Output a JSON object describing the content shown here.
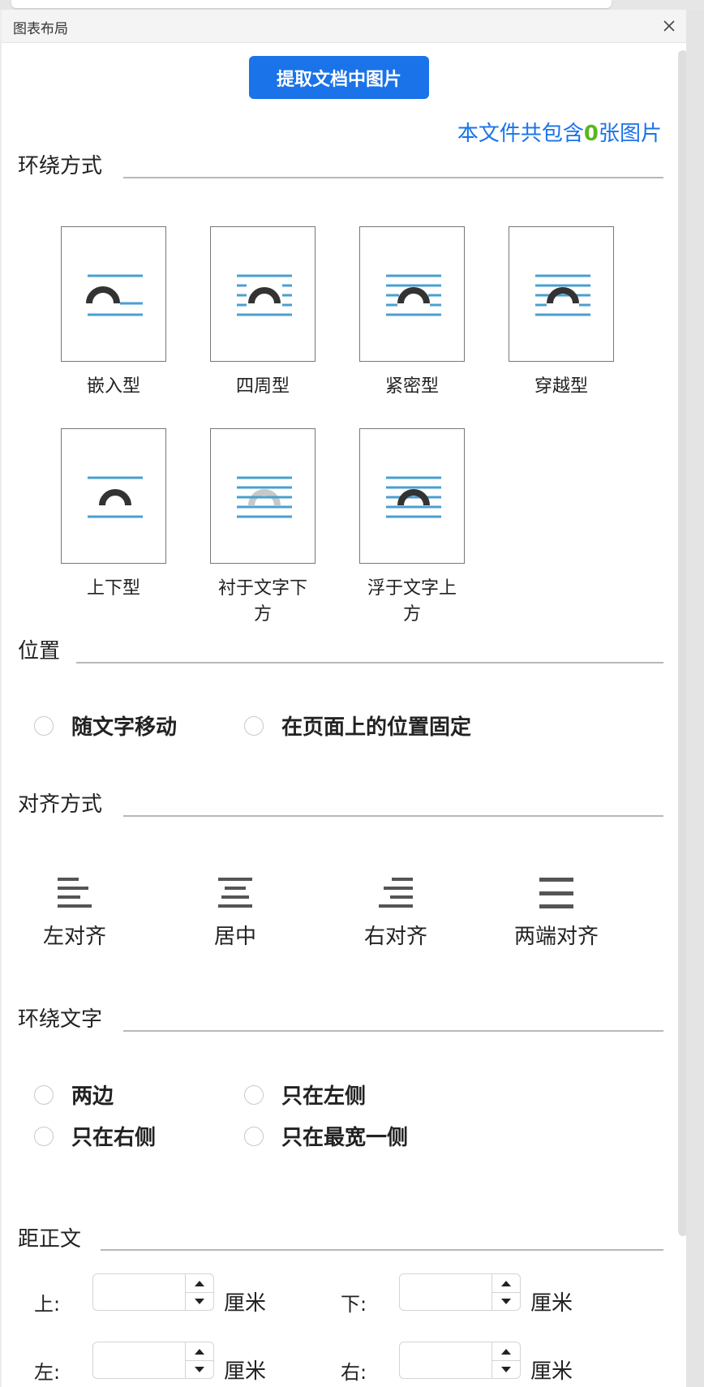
{
  "dialog": {
    "title": "图表布局"
  },
  "extract": {
    "button_label": "提取文档中图片",
    "count_prefix": "本文件共包含",
    "count": "0",
    "count_suffix": "张图片"
  },
  "sections": {
    "wrap_mode": "环绕方式",
    "position": "位置",
    "alignment": "对齐方式",
    "wrap_text": "环绕文字",
    "distance": "距正文"
  },
  "wrap_modes": [
    "嵌入型",
    "四周型",
    "紧密型",
    "穿越型",
    "上下型",
    "衬于文字下方",
    "浮于文字上方"
  ],
  "position_options": [
    "随文字移动",
    "在页面上的位置固定"
  ],
  "alignment_options": [
    "左对齐",
    "居中",
    "右对齐",
    "两端对齐"
  ],
  "wrap_text_options": [
    "两边",
    "只在左侧",
    "只在右侧",
    "只在最宽一侧"
  ],
  "distance": {
    "top_label": "上:",
    "bottom_label": "下:",
    "left_label": "左:",
    "right_label": "右:",
    "unit": "厘米",
    "top_value": "",
    "bottom_value": "",
    "left_value": "",
    "right_value": ""
  },
  "colors": {
    "accent": "#1a73e8",
    "count_number": "#58b81d",
    "wrap_line": "#4a9fd0",
    "wrap_shape": "#333333"
  },
  "icons": {
    "close": "close-icon",
    "spin_up": "caret-up-icon",
    "spin_down": "caret-down-icon"
  }
}
